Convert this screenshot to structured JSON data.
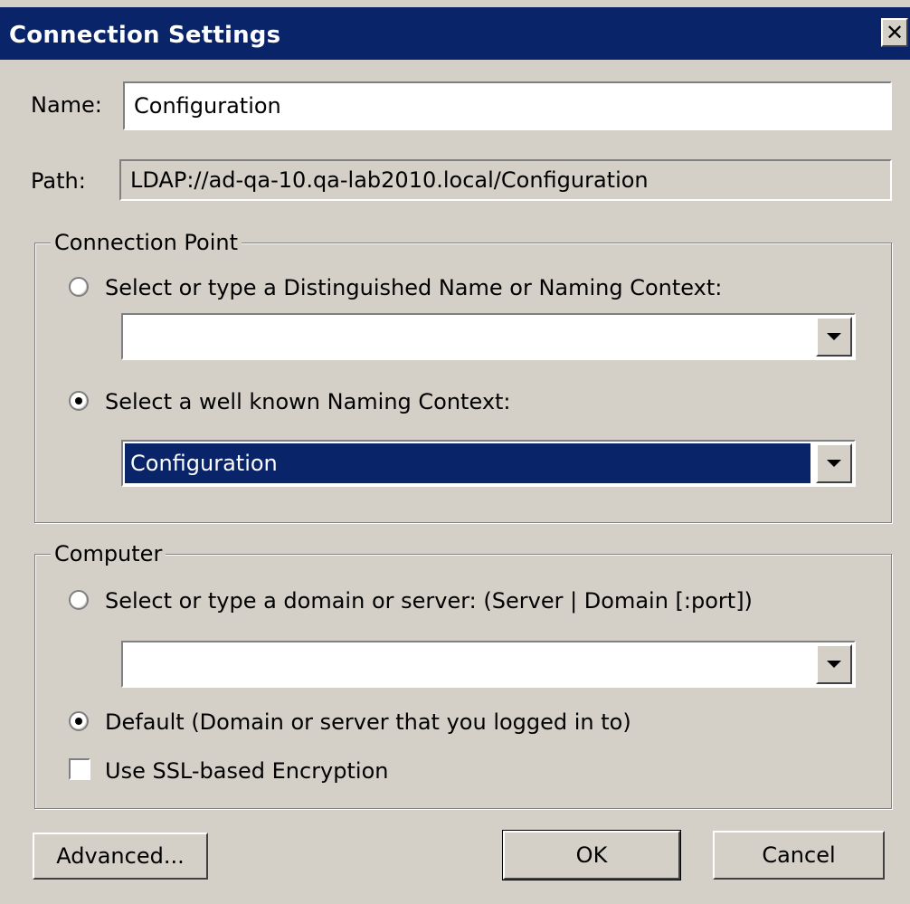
{
  "window": {
    "title": "Connection Settings",
    "close_glyph": "✕"
  },
  "fields": {
    "name_label": "Name:",
    "name_value": "Configuration",
    "path_label": "Path:",
    "path_value": "LDAP://ad-qa-10.qa-lab2010.local/Configuration"
  },
  "connection_point": {
    "legend": "Connection Point",
    "radio_dn_label": "Select or type a Distinguished Name or Naming Context:",
    "radio_dn_selected": false,
    "dn_combo_value": "",
    "radio_wk_label": "Select a well known Naming Context:",
    "radio_wk_selected": true,
    "wk_combo_value": "Configuration"
  },
  "computer": {
    "legend": "Computer",
    "radio_server_label": "Select or type a domain or server: (Server | Domain [:port])",
    "radio_server_selected": false,
    "server_combo_value": "",
    "radio_default_label": "Default (Domain or server that you logged in to)",
    "radio_default_selected": true,
    "ssl_label": "Use SSL-based Encryption",
    "ssl_checked": false
  },
  "buttons": {
    "advanced": "Advanced...",
    "ok": "OK",
    "cancel": "Cancel"
  },
  "colors": {
    "title_bar": "#0a246a",
    "dialog_bg": "#d4d0c8",
    "selection": "#0a246a"
  }
}
